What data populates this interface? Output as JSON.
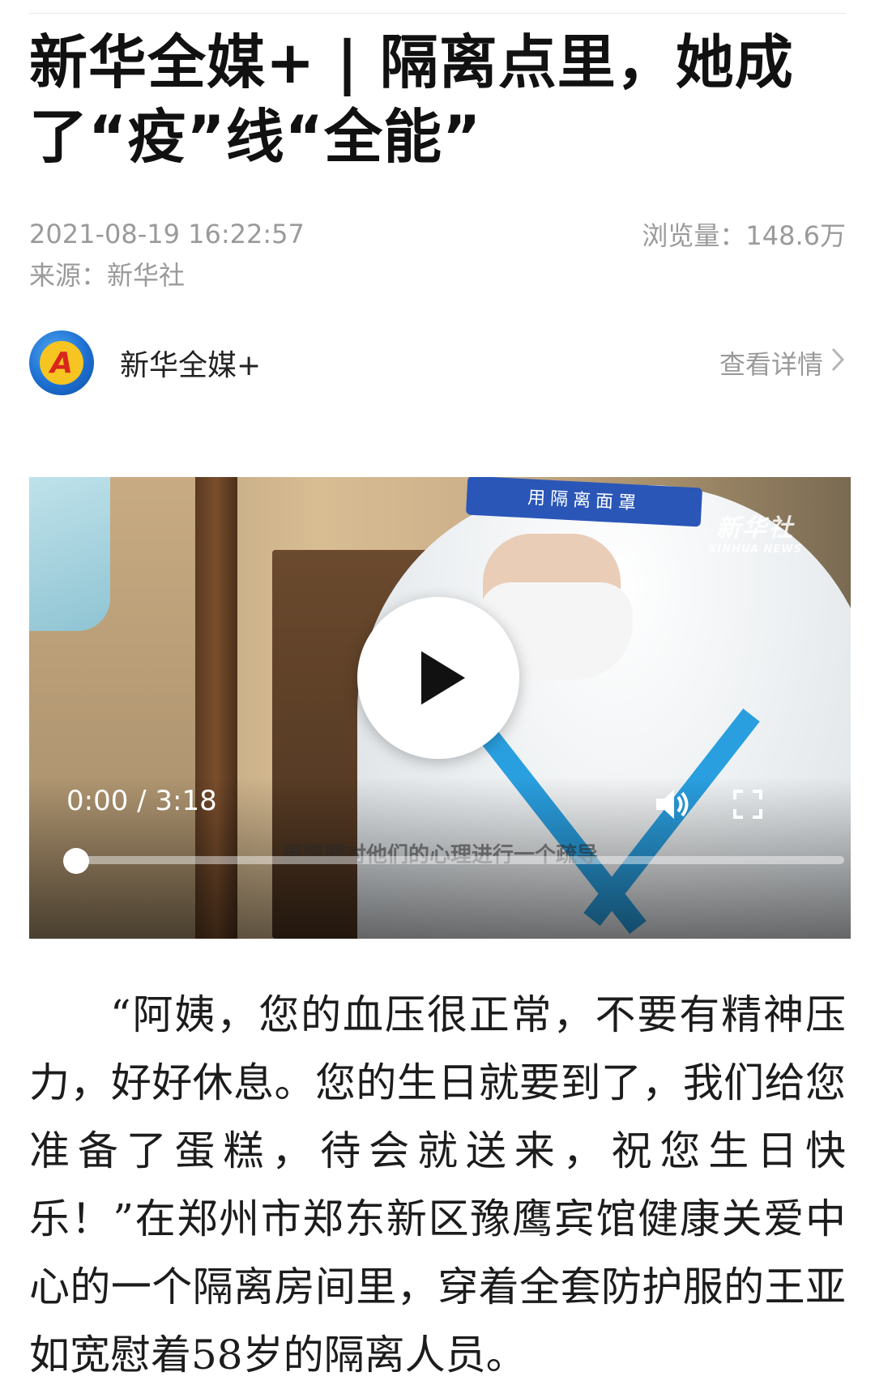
{
  "article": {
    "title": "新华全媒+ | 隔离点里，她成了“疫”线“全能”",
    "datetime": "2021-08-19 16:22:57",
    "views_label": "浏览量：",
    "views_value": "148.6万",
    "source": "来源：新华社",
    "body": "“阿姨，您的血压很正常，不要有精神压力，好好休息。您的生日就要到了，我们给您准备了蛋糕，待会就送来，祝您生日快乐！”在郑州市郑东新区豫鹰宾馆健康关爱中心的一个隔离房间里，穿着全套防护服的王亚如宽慰着58岁的隔离人员。"
  },
  "account": {
    "logo_letter": "A",
    "name": "新华全媒+",
    "details_link": "查看详情",
    "chevron_icon": "chevron-right-icon"
  },
  "video": {
    "current_time": "0:00",
    "duration": "3:18",
    "time_display": "0:00 / 3:18",
    "subtitle": "更需要对他们的心理进行一个疏导",
    "watermark_cn": "新华社",
    "watermark_en": "XINHUA NEWS",
    "visor_text": "用隔离面罩",
    "progress_fraction": 0.0,
    "icons": {
      "play": "play-icon",
      "volume": "volume-icon",
      "fullscreen": "fullscreen-icon"
    }
  },
  "colors": {
    "title": "#111111",
    "meta": "#9a9a9a",
    "link": "#9a9a9a",
    "logo_blue": "#1d6fd1",
    "logo_yellow": "#f6c521",
    "logo_red": "#d8261d"
  }
}
